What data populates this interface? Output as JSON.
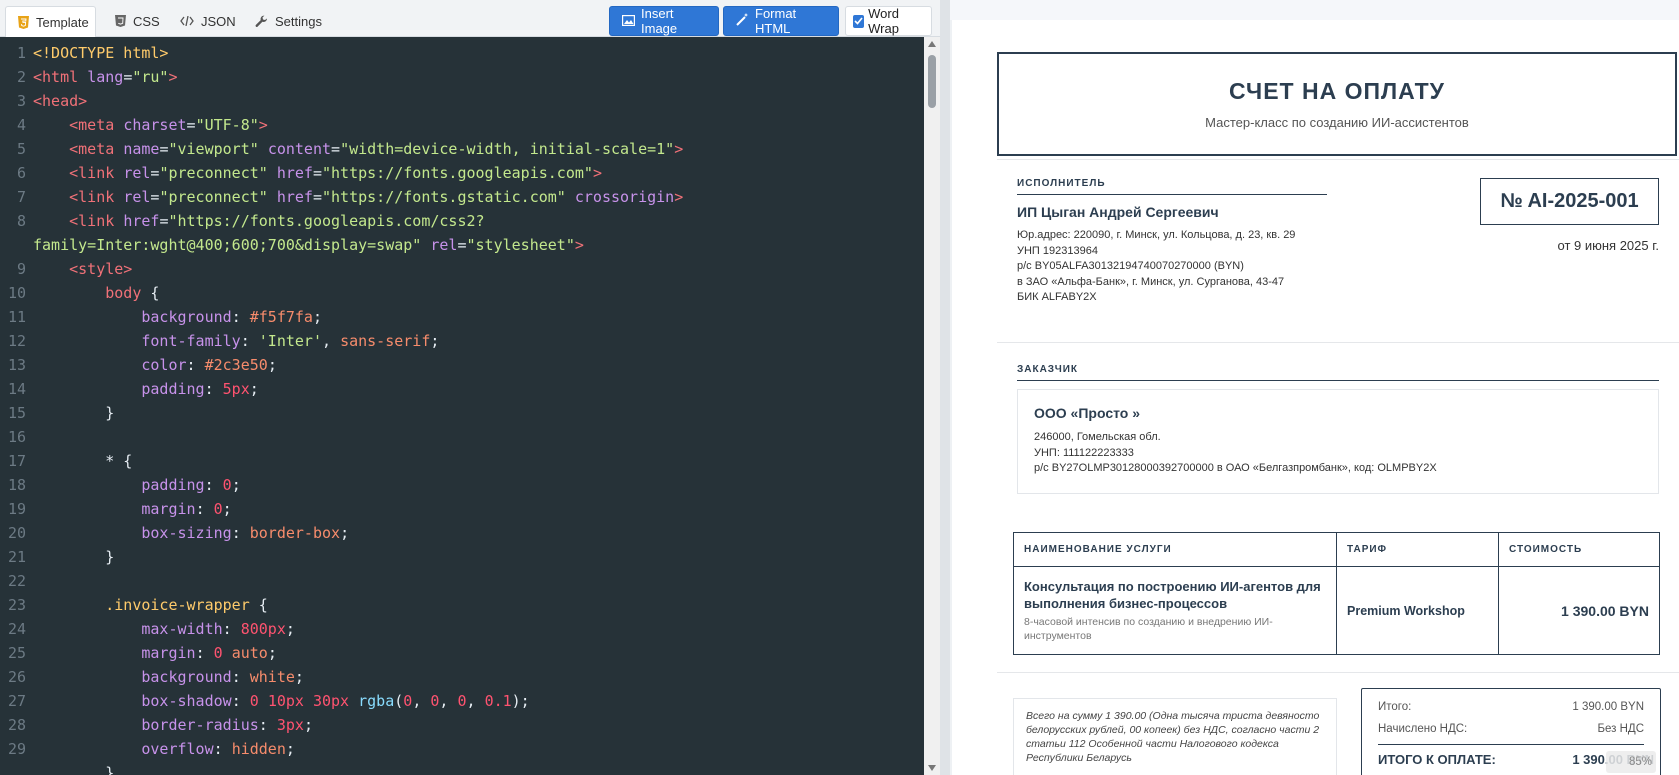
{
  "tabs": [
    {
      "label": "Template",
      "active": true,
      "icon": "html5-icon"
    },
    {
      "label": "CSS",
      "icon": "css3-icon"
    },
    {
      "label": "JSON",
      "icon": "code-icon"
    },
    {
      "label": "Settings",
      "icon": "wrench-icon"
    }
  ],
  "toolbar": {
    "insert_image": "Insert Image",
    "format_html": "Format HTML",
    "word_wrap": "Word Wrap",
    "word_wrap_checked": true
  },
  "code_lines": [
    {
      "n": "1",
      "html": "<span class=\"d\">&lt;!DOCTYPE html&gt;</span>"
    },
    {
      "n": "2",
      "html": "<span class=\"t\">&lt;html</span> <span class=\"a\">lang</span>=<span class=\"s\">\"ru\"</span><span class=\"t\">&gt;</span>"
    },
    {
      "n": "3",
      "html": "<span class=\"t\">&lt;head&gt;</span>"
    },
    {
      "n": "4",
      "html": "    <span class=\"t\">&lt;meta</span> <span class=\"a\">charset</span>=<span class=\"s\">\"UTF-8\"</span><span class=\"t\">&gt;</span>"
    },
    {
      "n": "5",
      "html": "    <span class=\"t\">&lt;meta</span> <span class=\"a\">name</span>=<span class=\"s\">\"viewport\"</span> <span class=\"a\">content</span>=<span class=\"s\">\"width=device-width, initial-scale=1\"</span><span class=\"t\">&gt;</span>"
    },
    {
      "n": "6",
      "html": "    <span class=\"t\">&lt;link</span> <span class=\"a\">rel</span>=<span class=\"s\">\"preconnect\"</span> <span class=\"a\">href</span>=<span class=\"s\">\"https://fonts.googleapis.com\"</span><span class=\"t\">&gt;</span>"
    },
    {
      "n": "7",
      "html": "    <span class=\"t\">&lt;link</span> <span class=\"a\">rel</span>=<span class=\"s\">\"preconnect\"</span> <span class=\"a\">href</span>=<span class=\"s\">\"https://fonts.gstatic.com\"</span> <span class=\"a\">crossorigin</span><span class=\"t\">&gt;</span>"
    },
    {
      "n": "8",
      "html": "    <span class=\"t\">&lt;link</span> <span class=\"a\">href</span>=<span class=\"s\">\"https://fonts.googleapis.com/css2?</span>"
    },
    {
      "n": "",
      "html": "<span class=\"s\">family=Inter:wght@400;600;700&amp;display=swap\"</span> <span class=\"a\">rel</span>=<span class=\"s\">\"stylesheet\"</span><span class=\"t\">&gt;</span>"
    },
    {
      "n": "9",
      "html": "    <span class=\"t\">&lt;style&gt;</span>"
    },
    {
      "n": "10",
      "html": "        <span class=\"t\">body</span> {"
    },
    {
      "n": "11",
      "html": "            <span class=\"a\">background</span>: <span class=\"v\">#f5f7fa</span>;"
    },
    {
      "n": "12",
      "html": "            <span class=\"a\">font-family</span>: <span class=\"s\">'Inter'</span>, <span class=\"v\">sans-serif</span>;"
    },
    {
      "n": "13",
      "html": "            <span class=\"a\">color</span>: <span class=\"v\">#2c3e50</span>;"
    },
    {
      "n": "14",
      "html": "            <span class=\"a\">padding</span>: <span class=\"n\">5px</span>;"
    },
    {
      "n": "15",
      "html": "        }"
    },
    {
      "n": "16",
      "html": ""
    },
    {
      "n": "17",
      "html": "        * {"
    },
    {
      "n": "18",
      "html": "            <span class=\"a\">padding</span>: <span class=\"n\">0</span>;"
    },
    {
      "n": "19",
      "html": "            <span class=\"a\">margin</span>: <span class=\"n\">0</span>;"
    },
    {
      "n": "20",
      "html": "            <span class=\"a\">box-sizing</span>: <span class=\"v\">border-box</span>;"
    },
    {
      "n": "21",
      "html": "        }"
    },
    {
      "n": "22",
      "html": ""
    },
    {
      "n": "23",
      "html": "        <span class=\"sel\">.invoice-wrapper</span> {"
    },
    {
      "n": "24",
      "html": "            <span class=\"a\">max-width</span>: <span class=\"n\">800px</span>;"
    },
    {
      "n": "25",
      "html": "            <span class=\"a\">margin</span>: <span class=\"n\">0</span> <span class=\"v\">auto</span>;"
    },
    {
      "n": "26",
      "html": "            <span class=\"a\">background</span>: <span class=\"v\">white</span>;"
    },
    {
      "n": "27",
      "html": "            <span class=\"a\">box-shadow</span>: <span class=\"n\">0</span> <span class=\"n\">10px</span> <span class=\"n\">30px</span> <span class=\"p\">rgba</span>(<span class=\"n\">0</span>, <span class=\"n\">0</span>, <span class=\"n\">0</span>, <span class=\"n\">0.1</span>);"
    },
    {
      "n": "28",
      "html": "            <span class=\"a\">border-radius</span>: <span class=\"n\">3px</span>;"
    },
    {
      "n": "29",
      "html": "            <span class=\"a\">overflow</span>: <span class=\"v\">hidden</span>;"
    },
    {
      "n": "",
      "html": "        }"
    }
  ],
  "invoice": {
    "title": "СЧЕТ НА ОПЛАТУ",
    "subtitle": "Мастер-класс по созданию ИИ-ассистентов",
    "executor_label": "ИСПОЛНИТЕЛЬ",
    "executor_name": "ИП Цыган Андрей Сергеевич",
    "executor_lines": [
      "Юр.адрес: 220090, г. Минск, ул. Кольцова, д. 23, кв. 29",
      "УНП 192313964",
      "р/с BY05ALFA30132194740070270000 (BYN)",
      "в ЗАО «Альфа-Банк», г. Минск, ул. Сурганова, 43-47",
      "БИК ALFABY2X"
    ],
    "number": "№ AI-2025-001",
    "date": "от 9 июня 2025 г.",
    "customer_label": "ЗАКАЗЧИК",
    "customer_name": "ООО «Просто »",
    "customer_lines": [
      "246000, Гомельская обл.",
      "УНП: 111122223333",
      "р/с BY27OLMP30128000392700000 в ОАО «Белгазпромбанк», код: OLMPBY2X"
    ],
    "table_headers": [
      "НАИМЕНОВАНИЕ УСЛУГИ",
      "ТАРИФ",
      "СТОИМОСТЬ"
    ],
    "service_title": "Консультация по построению ИИ-агентов для выполнения бизнес-процессов",
    "service_desc": "8-часовой интенсив по созданию и внедрению ИИ-инструментов",
    "tariff": "Premium Workshop",
    "cost": "1 390.00 BYN",
    "sum_words": "Всего на сумму 1 390.00 (Одна тысяча триста девяносто белорусских рублей, 00 копеек) без НДС, согласно части 2 статьи 112 Особенной части Налогового кодекса Республики Беларусь",
    "subtotal_label": "Итого:",
    "subtotal_value": "1 390.00 BYN",
    "vat_label": "Начислено НДС:",
    "vat_value": "Без НДС",
    "total_label": "ИТОГО К ОПЛАТЕ:",
    "total_value": "1 390.00 BYN",
    "zoom": "85%"
  }
}
